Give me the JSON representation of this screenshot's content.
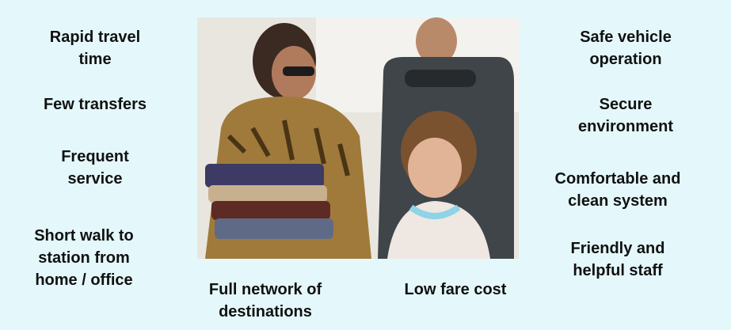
{
  "left_labels": [
    "Rapid travel\ntime",
    "Few transfers",
    "Frequent\nservice",
    "Short walk to\nstation from\nhome / office"
  ],
  "right_labels": [
    "Safe vehicle\noperation",
    "Secure\nenvironment",
    "Comfortable and\nclean system",
    "Friendly and\nhelpful staff"
  ],
  "bottom_labels": [
    "Full network of\ndestinations",
    "Low fare cost"
  ],
  "photo": {
    "icon": "bus-passengers-photo"
  },
  "colors": {
    "background": "#e4f8fb",
    "text": "#111111"
  }
}
